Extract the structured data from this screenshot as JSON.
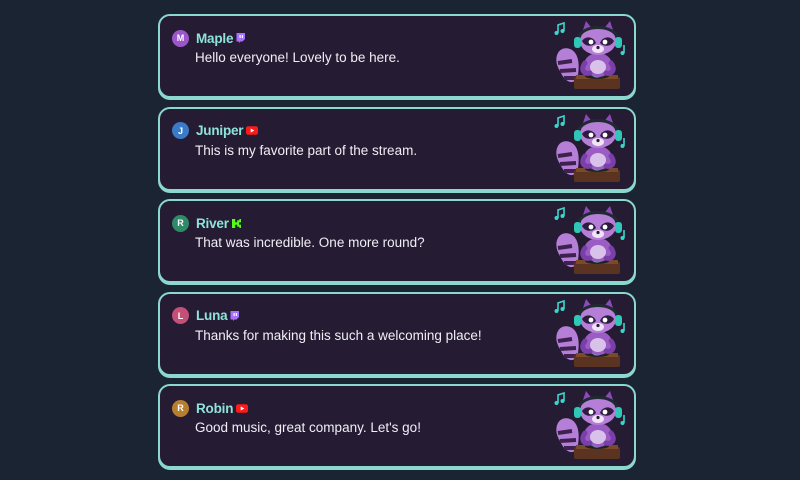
{
  "messages": [
    {
      "initial": "M",
      "name": "Maple",
      "text": "Hello everyone! Lovely to be here.",
      "avatar_color": "#9b57c9",
      "platform": "twitch-icon"
    },
    {
      "initial": "J",
      "name": "Juniper",
      "text": "This is my favorite part of the stream.",
      "avatar_color": "#3a7bc8",
      "platform": "youtube-icon"
    },
    {
      "initial": "R",
      "name": "River",
      "text": "That was incredible. One more round?",
      "avatar_color": "#2f8a68",
      "platform": "kick-icon"
    },
    {
      "initial": "L",
      "name": "Luna",
      "text": "Thanks for making this such a welcoming place!",
      "avatar_color": "#c44f77",
      "platform": "twitch-icon"
    },
    {
      "initial": "R",
      "name": "Robin",
      "text": "Good music, great company. Let's go!",
      "avatar_color": "#b77e2e",
      "platform": "youtube-icon"
    }
  ],
  "mascot": "raccoon-dj-icon",
  "colors": {
    "background": "#1b2433",
    "card": "#251c33",
    "border": "#8ad8ce",
    "username": "#8ee3d9",
    "twitch": "#a970ff",
    "youtube": "#ff1a1a",
    "kick": "#53fc18"
  }
}
